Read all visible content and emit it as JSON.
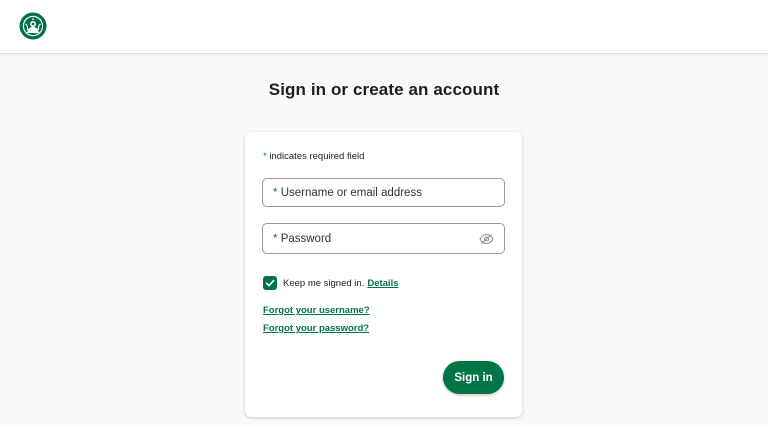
{
  "header": {
    "logo": "starbucks-siren-logo",
    "brand_color": "#00754a"
  },
  "page": {
    "title": "Sign in or create an account"
  },
  "form": {
    "required_star": "*",
    "required_note": "indicates required field",
    "username": {
      "star": "*",
      "label": "Username or email address",
      "value": ""
    },
    "password": {
      "star": "*",
      "label": "Password",
      "value": "",
      "toggle_icon": "eye-icon"
    },
    "keep_signed_in": {
      "checked": true,
      "label": "Keep me signed in.",
      "details_link": "Details"
    },
    "forgot_username": "Forgot your username?",
    "forgot_password": "Forgot your password?",
    "submit_label": "Sign in"
  }
}
